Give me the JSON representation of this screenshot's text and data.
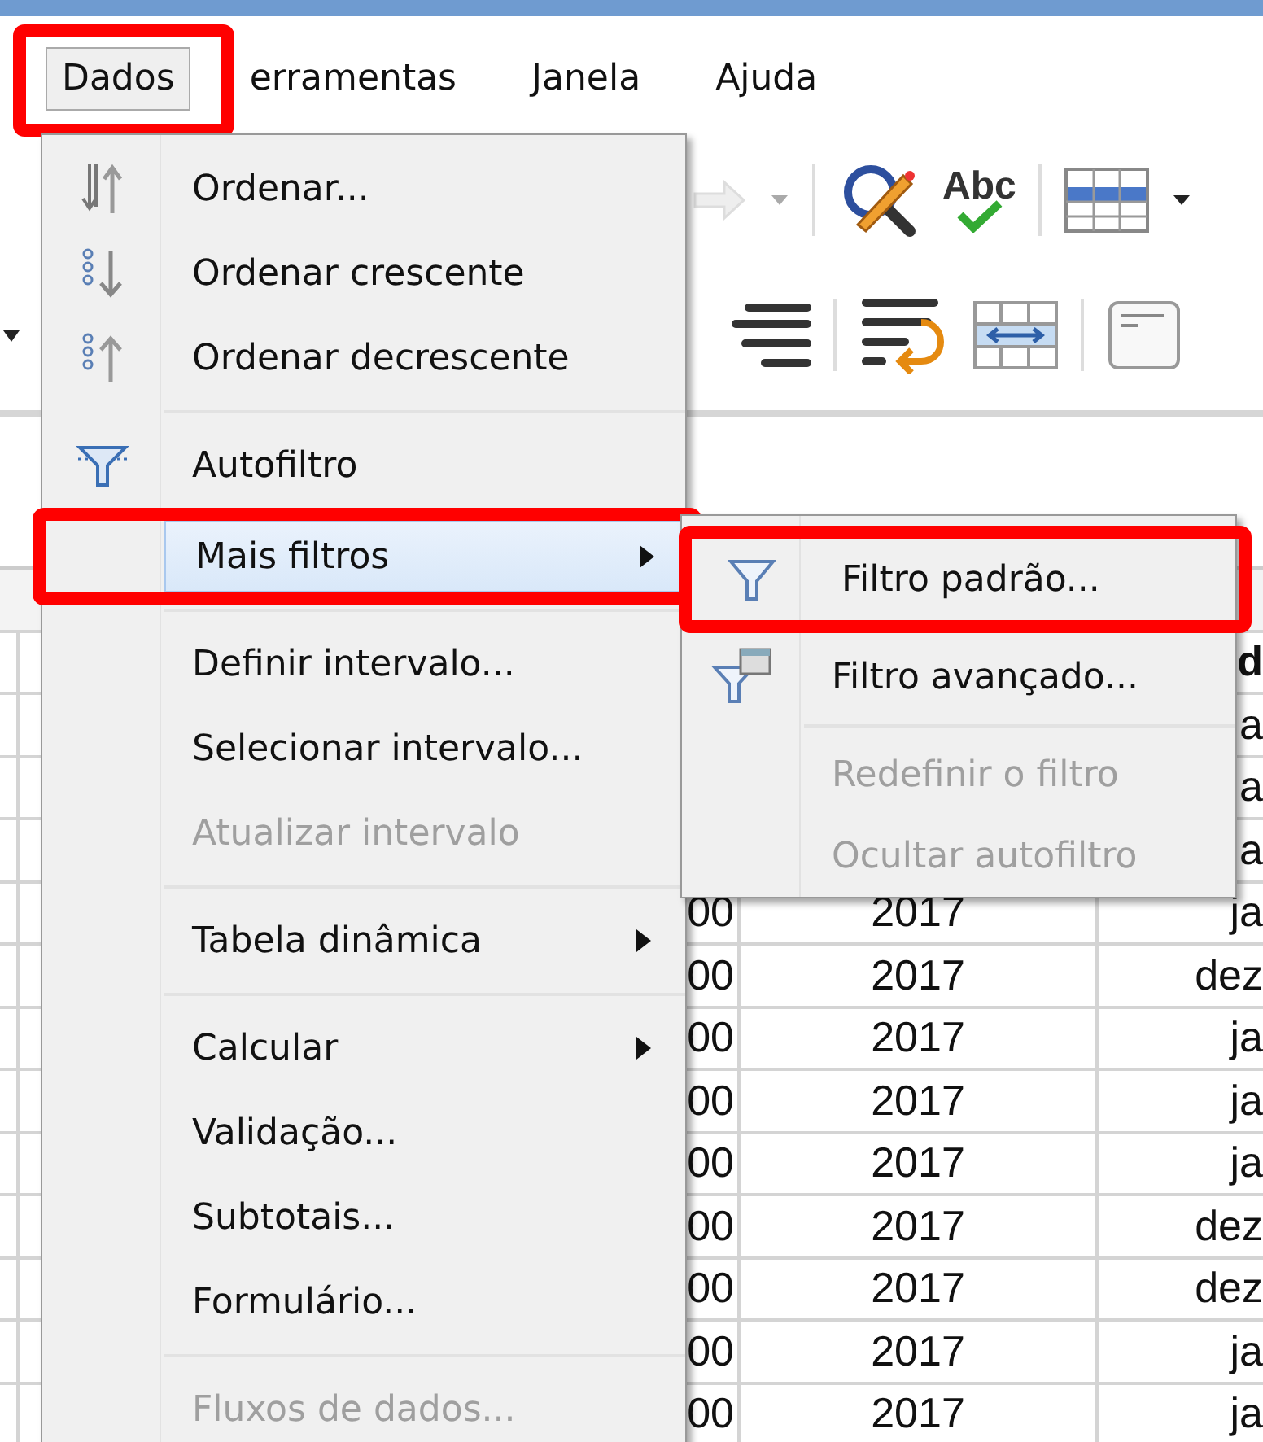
{
  "menubar": [
    {
      "label": "Dados",
      "selected": true,
      "highlighted": true
    },
    {
      "label": "erramentas",
      "selected": false,
      "highlighted": false
    },
    {
      "label": "Janela",
      "selected": false,
      "highlighted": false
    },
    {
      "label": "Ajuda",
      "selected": false,
      "highlighted": false
    }
  ],
  "toolbar": {
    "spelling_label": "Abc"
  },
  "sheet": {
    "upper_rows": [
      {
        "kind": "header",
        "text": "d"
      },
      {
        "kind": "data",
        "text": "a"
      },
      {
        "kind": "data",
        "text": "a"
      },
      {
        "kind": "data",
        "text": "a"
      }
    ],
    "rows": [
      {
        "cells": [
          "00",
          "2017",
          "ja"
        ]
      },
      {
        "cells": [
          "00",
          "2017",
          "dez"
        ]
      },
      {
        "cells": [
          "00",
          "2017",
          "ja"
        ]
      },
      {
        "cells": [
          "00",
          "2017",
          "ja"
        ]
      },
      {
        "cells": [
          "00",
          "2017",
          "ja"
        ]
      },
      {
        "cells": [
          "00",
          "2017",
          "dez"
        ]
      },
      {
        "cells": [
          "00",
          "2017",
          "dez"
        ]
      },
      {
        "cells": [
          "00",
          "2017",
          "ja"
        ]
      },
      {
        "cells": [
          "00",
          "2017",
          "ja"
        ]
      }
    ]
  },
  "data_menu": {
    "items": [
      {
        "kind": "item",
        "label": "Ordenar...",
        "disabled": false,
        "submenu": false,
        "selected": false,
        "highlighted": false
      },
      {
        "kind": "item",
        "label": "Ordenar crescente",
        "disabled": false,
        "submenu": false,
        "selected": false,
        "highlighted": false
      },
      {
        "kind": "item",
        "label": "Ordenar decrescente",
        "disabled": false,
        "submenu": false,
        "selected": false,
        "highlighted": false
      },
      {
        "kind": "separator"
      },
      {
        "kind": "item",
        "label": "Autofiltro",
        "disabled": false,
        "submenu": false,
        "selected": false,
        "highlighted": false
      },
      {
        "kind": "item",
        "label": "Mais filtros",
        "disabled": false,
        "submenu": true,
        "selected": true,
        "highlighted": true
      },
      {
        "kind": "separator"
      },
      {
        "kind": "item",
        "label": "Definir intervalo...",
        "disabled": false,
        "submenu": false,
        "selected": false,
        "highlighted": false
      },
      {
        "kind": "item",
        "label": "Selecionar intervalo...",
        "disabled": false,
        "submenu": false,
        "selected": false,
        "highlighted": false
      },
      {
        "kind": "item",
        "label": "Atualizar intervalo",
        "disabled": true,
        "submenu": false,
        "selected": false,
        "highlighted": false
      },
      {
        "kind": "separator"
      },
      {
        "kind": "item",
        "label": "Tabela dinâmica",
        "disabled": false,
        "submenu": true,
        "selected": false,
        "highlighted": false
      },
      {
        "kind": "separator"
      },
      {
        "kind": "item",
        "label": "Calcular",
        "disabled": false,
        "submenu": true,
        "selected": false,
        "highlighted": false
      },
      {
        "kind": "item",
        "label": "Validação...",
        "disabled": false,
        "submenu": false,
        "selected": false,
        "highlighted": false
      },
      {
        "kind": "item",
        "label": "Subtotais...",
        "disabled": false,
        "submenu": false,
        "selected": false,
        "highlighted": false
      },
      {
        "kind": "item",
        "label": "Formulário...",
        "disabled": false,
        "submenu": false,
        "selected": false,
        "highlighted": false
      },
      {
        "kind": "separator"
      },
      {
        "kind": "item",
        "label": "Fluxos de dados...",
        "disabled": true,
        "submenu": false,
        "selected": false,
        "highlighted": false
      }
    ]
  },
  "filters_submenu": {
    "items": [
      {
        "kind": "item",
        "label": "Filtro padrão...",
        "disabled": false,
        "submenu": false,
        "selected": false,
        "highlighted": true
      },
      {
        "kind": "item",
        "label": "Filtro avançado...",
        "disabled": false,
        "submenu": false,
        "selected": false,
        "highlighted": false
      },
      {
        "kind": "separator"
      },
      {
        "kind": "item",
        "label": "Redefinir o filtro",
        "disabled": true,
        "submenu": false,
        "selected": false,
        "highlighted": false
      },
      {
        "kind": "item",
        "label": "Ocultar autofiltro",
        "disabled": true,
        "submenu": false,
        "selected": false,
        "highlighted": false
      }
    ]
  }
}
